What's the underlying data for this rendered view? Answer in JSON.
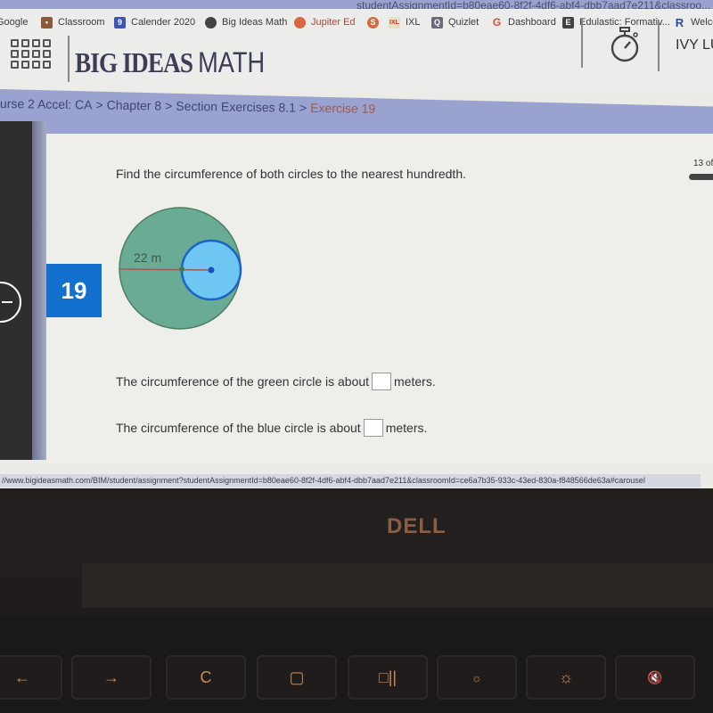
{
  "browser": {
    "url_visible": "studentAssignmentId=b80eae60-8f2f-4df6-abf4-dbb7aad7e211&classroo...",
    "url_prefix_partial": "...assignment?",
    "bookmarks": [
      {
        "label": "Google",
        "icon": "google-icon"
      },
      {
        "label": "Classroom",
        "icon": "classroom-icon"
      },
      {
        "label": "Calender 2020",
        "icon": "calendar-icon"
      },
      {
        "label": "Big Ideas Math",
        "icon": "big-ideas-icon"
      },
      {
        "label": "Jupiter Ed",
        "icon": "jupiter-icon"
      },
      {
        "label": "",
        "icon": "orange-circle-icon"
      },
      {
        "label": "IXL",
        "icon": "ixl-icon"
      },
      {
        "label": "Quizlet",
        "icon": "quizlet-icon"
      },
      {
        "label": "Dashboard",
        "icon": "google-g-icon"
      },
      {
        "label": "Edulastic: Formativ...",
        "icon": "edulastic-icon"
      },
      {
        "label": "Welco",
        "icon": "r-icon"
      }
    ],
    "status_url": "//www.bigideasmath.com/BIM/student/assignment?studentAssignmentId=b80eae60-8f2f-4df6-abf4-dbb7aad7e211&classroomId=ce6a7b35-933c-43ed-830a-f848566de63a#carousel"
  },
  "header": {
    "logo_bold": "BIG IDEAS",
    "logo_light": "MATH",
    "user_name": "IVY LU"
  },
  "breadcrumb": {
    "items": [
      "urse 2 Accel: CA",
      ">",
      "Chapter 8",
      ">",
      "Section Exercises 8.1",
      ">"
    ],
    "current": "Exercise 19"
  },
  "exercise": {
    "number": "19",
    "counter": "13 of",
    "prompt": "Find the circumference of both circles to the nearest hundredth.",
    "figure": {
      "label": "22 m",
      "green_color": "#6aab95",
      "blue_color": "#6ec7f2",
      "blue_stroke": "#1a63c9",
      "radius_line_color": "#a25a55"
    },
    "q1_text": "The circumference of the green circle is about",
    "q1_value": "",
    "q1_unit": "meters.",
    "q2_text": "The circumference of the blue circle is about",
    "q2_value": "",
    "q2_unit": "meters."
  },
  "laptop": {
    "brand": "DELL",
    "keys": [
      "←",
      "→",
      "C",
      "▢",
      "□||",
      "☼",
      "☼",
      "🔇"
    ]
  }
}
